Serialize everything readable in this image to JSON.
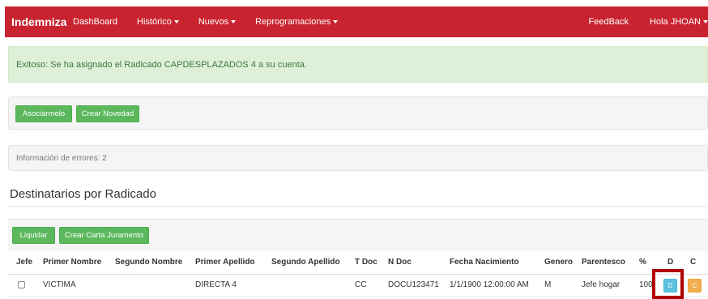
{
  "navbar": {
    "brand": "Indemniza",
    "items": [
      "DashBoard",
      "Histórico",
      "Nuevos",
      "Reprogramaciones"
    ],
    "feedback": "FeedBack",
    "user": "Hola JHOAN"
  },
  "alert": {
    "message": "Exitoso: Se ha asignado el Radicado CAPDESPLAZADOS 4 a su cuenta."
  },
  "actions": {
    "assign": "Asociarmelo",
    "new_novelty": "Crear Novedad"
  },
  "errors": {
    "text": "Información de errores: 2"
  },
  "section": {
    "title": "Destinatarios por Radicado"
  },
  "table_actions": {
    "liquidate": "Liquidar",
    "oath_letter": "Crear Carta Juramento"
  },
  "table": {
    "headers": [
      "Jefe",
      "Primer Nombre",
      "Segundo Nombre",
      "Primer Apellido",
      "Segundo Apellido",
      "T Doc",
      "N Doc",
      "Fecha Nacimiento",
      "Genero",
      "Parentesco",
      "%",
      "D",
      "C"
    ],
    "rows": [
      {
        "primer_nombre": "VICTIMA",
        "segundo_nombre": "",
        "primer_apellido": "DIRECTA 4",
        "segundo_apellido": "",
        "t_doc": "CC",
        "n_doc": "DOCU123471",
        "fecha_nacimiento": "1/1/1900 12:00:00 AM",
        "genero": "M",
        "parentesco": "Jefe hogar",
        "porcentaje": "100",
        "d_button": "D",
        "c_button": "C"
      }
    ]
  },
  "colors": {
    "navbar": "#c9232f",
    "success_bg": "#dff0d8",
    "success_text": "#3c763d",
    "btn_success": "#5cb85c",
    "btn_info": "#5bc0de",
    "btn_warning": "#f0ad4e",
    "highlight": "#b00000"
  }
}
